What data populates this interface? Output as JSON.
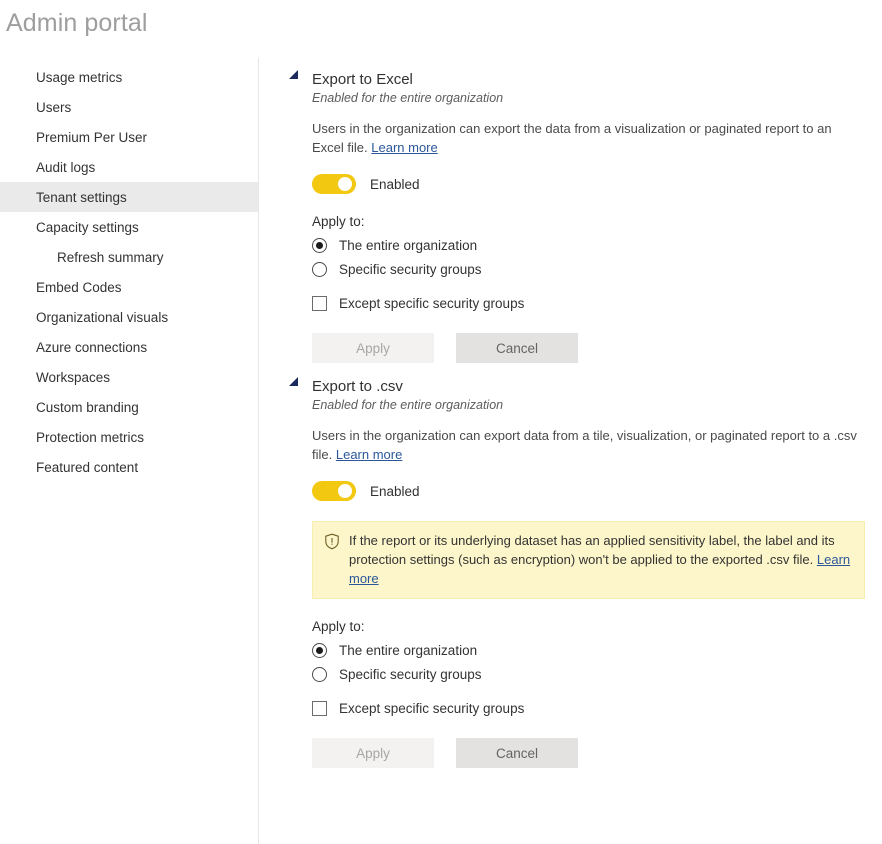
{
  "header": {
    "title": "Admin portal"
  },
  "sidebar": {
    "items": [
      {
        "label": "Usage metrics",
        "selected": false,
        "indent": false
      },
      {
        "label": "Users",
        "selected": false,
        "indent": false
      },
      {
        "label": "Premium Per User",
        "selected": false,
        "indent": false
      },
      {
        "label": "Audit logs",
        "selected": false,
        "indent": false
      },
      {
        "label": "Tenant settings",
        "selected": true,
        "indent": false
      },
      {
        "label": "Capacity settings",
        "selected": false,
        "indent": false
      },
      {
        "label": "Refresh summary",
        "selected": false,
        "indent": true
      },
      {
        "label": "Embed Codes",
        "selected": false,
        "indent": false
      },
      {
        "label": "Organizational visuals",
        "selected": false,
        "indent": false
      },
      {
        "label": "Azure connections",
        "selected": false,
        "indent": false
      },
      {
        "label": "Workspaces",
        "selected": false,
        "indent": false
      },
      {
        "label": "Custom branding",
        "selected": false,
        "indent": false
      },
      {
        "label": "Protection metrics",
        "selected": false,
        "indent": false
      },
      {
        "label": "Featured content",
        "selected": false,
        "indent": false
      }
    ]
  },
  "settings": {
    "export_excel": {
      "title": "Export to Excel",
      "status": "Enabled for the entire organization",
      "description": "Users in the organization can export the data from a visualization or paginated report to an Excel file.",
      "learn_more": "Learn more",
      "toggle_label": "Enabled",
      "toggle_on": true,
      "apply_to_label": "Apply to:",
      "radio_entire": "The entire organization",
      "radio_specific": "Specific security groups",
      "radio_selected": "entire",
      "checkbox_except": "Except specific security groups",
      "checkbox_checked": false,
      "apply_button": "Apply",
      "cancel_button": "Cancel"
    },
    "export_csv": {
      "title": "Export to .csv",
      "status": "Enabled for the entire organization",
      "description": "Users in the organization can export data from a tile, visualization, or paginated report to a .csv file.",
      "learn_more": "Learn more",
      "toggle_label": "Enabled",
      "toggle_on": true,
      "banner_text": "If the report or its underlying dataset has an applied sensitivity label, the label and its protection settings (such as encryption) won't be applied to the exported .csv file.",
      "banner_learn_more": "Learn more",
      "apply_to_label": "Apply to:",
      "radio_entire": "The entire organization",
      "radio_specific": "Specific security groups",
      "radio_selected": "entire",
      "checkbox_except": "Except specific security groups",
      "checkbox_checked": false,
      "apply_button": "Apply",
      "cancel_button": "Cancel"
    }
  },
  "colors": {
    "toggle_on": "#f2c811",
    "link": "#2b579a",
    "banner_bg": "#fdf6ca",
    "selected_nav_bg": "#eaeaea"
  }
}
